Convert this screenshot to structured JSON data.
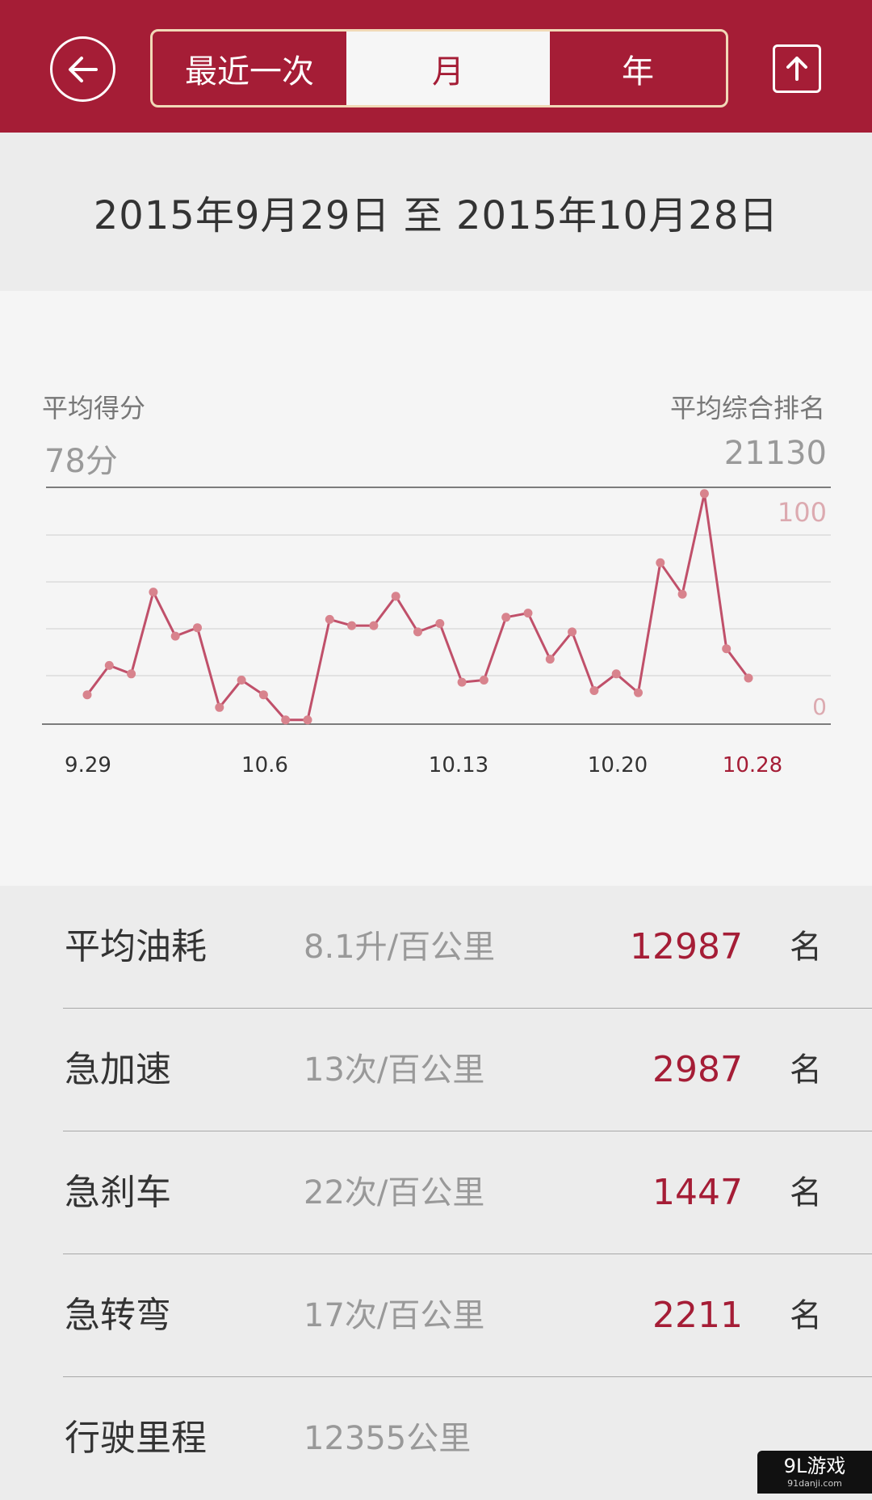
{
  "header": {
    "tabs": [
      {
        "label": "最近一次"
      },
      {
        "label": "月"
      },
      {
        "label": "年"
      }
    ],
    "selected_tab": "月",
    "back_icon": "arrow-left-icon",
    "share_icon": "upload-icon"
  },
  "date_range": "2015年9月29日 至 2015年10月28日",
  "summary": {
    "avg_score_label": "平均得分",
    "avg_score_value": "78分",
    "avg_rank_label": "平均综合排名",
    "avg_rank_value": "21130"
  },
  "chart_data": {
    "type": "line",
    "x": [
      "9.29",
      "9.30",
      "10.1",
      "10.2",
      "10.3",
      "10.4",
      "10.5",
      "10.6",
      "10.7",
      "10.8",
      "10.9",
      "10.10",
      "10.11",
      "10.12",
      "10.13",
      "10.14",
      "10.15",
      "10.16",
      "10.17",
      "10.18",
      "10.19",
      "10.20",
      "10.21",
      "10.22",
      "10.23",
      "10.24",
      "10.25",
      "10.26",
      "10.27",
      "10.28"
    ],
    "series": [
      {
        "values": [
          14,
          28,
          24,
          63,
          42,
          46,
          8,
          21,
          14,
          2,
          2,
          50,
          47,
          47,
          61,
          44,
          48,
          20,
          21,
          51,
          53,
          31,
          44,
          16,
          24,
          15,
          77,
          62,
          110,
          36,
          22
        ]
      }
    ],
    "x_tick_labels": [
      "9.29",
      "10.6",
      "10.13",
      "10.20",
      "10.28"
    ],
    "y_tick_labels": [
      "100",
      "0"
    ],
    "ylim": [
      0,
      100
    ],
    "grid": true,
    "colors": {
      "line": "#c0506a",
      "point": "#d8838d",
      "highlight_label": "#a51d36"
    }
  },
  "stats": [
    {
      "name": "平均油耗",
      "metric": "8.1升/百公里",
      "rank": "12987",
      "unit": "名"
    },
    {
      "name": "急加速",
      "metric": "13次/百公里",
      "rank": "2987",
      "unit": "名"
    },
    {
      "name": "急刹车",
      "metric": "22次/百公里",
      "rank": "1447",
      "unit": "名"
    },
    {
      "name": "急转弯",
      "metric": "17次/百公里",
      "rank": "2211",
      "unit": "名"
    },
    {
      "name": "行驶里程",
      "metric": "12355公里",
      "rank": "",
      "unit": ""
    }
  ],
  "watermark": {
    "text": "9L游戏",
    "sub": "91danji.com"
  },
  "colors": {
    "brand": "#a51d36",
    "accent_border": "#f1d9b7"
  }
}
